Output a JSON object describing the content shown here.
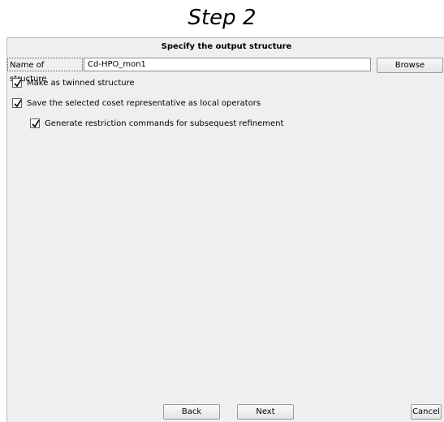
{
  "step_title": "Step 2",
  "dialog": {
    "heading": "Specify the output structure",
    "name_label": "Name of structure",
    "name_value": "Cd-HPO_mon1",
    "browse_label": "Browse",
    "options": [
      {
        "label": "Make as twinned structure",
        "checked": true
      },
      {
        "label": "Save the selected coset representative as local operators",
        "checked": true
      },
      {
        "label": "Generate restriction commands for subsequest refinement",
        "checked": true
      }
    ],
    "back_label": "Back",
    "next_label": "Next",
    "cancel_label": "Cancel"
  }
}
